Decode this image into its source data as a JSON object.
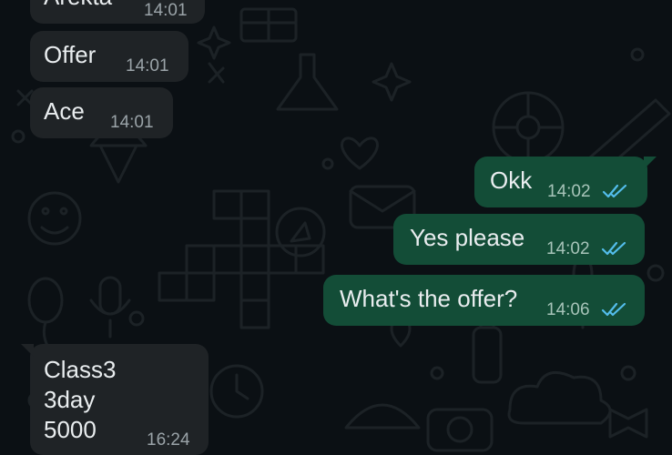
{
  "messages": [
    {
      "direction": "incoming",
      "text": "Arekta",
      "time": "14:01"
    },
    {
      "direction": "incoming",
      "text": "Offer",
      "time": "14:01"
    },
    {
      "direction": "incoming",
      "text": "Ace",
      "time": "14:01"
    },
    {
      "direction": "outgoing",
      "text": "Okk",
      "time": "14:02",
      "status_icon": "double-check-read-icon"
    },
    {
      "direction": "outgoing",
      "text": "Yes please",
      "time": "14:02",
      "status_icon": "double-check-read-icon"
    },
    {
      "direction": "outgoing",
      "text": "What's the offer?",
      "time": "14:06",
      "status_icon": "double-check-read-icon"
    },
    {
      "direction": "incoming",
      "text": "Class3\n3day\n5000",
      "time": "16:24"
    }
  ],
  "colors": {
    "background": "#0b1014",
    "incoming_bubble": "#1f2326",
    "outgoing_bubble": "#134d37",
    "read_tick": "#53bdeb",
    "text": "#e9edef",
    "time": "#9aa3a8"
  }
}
